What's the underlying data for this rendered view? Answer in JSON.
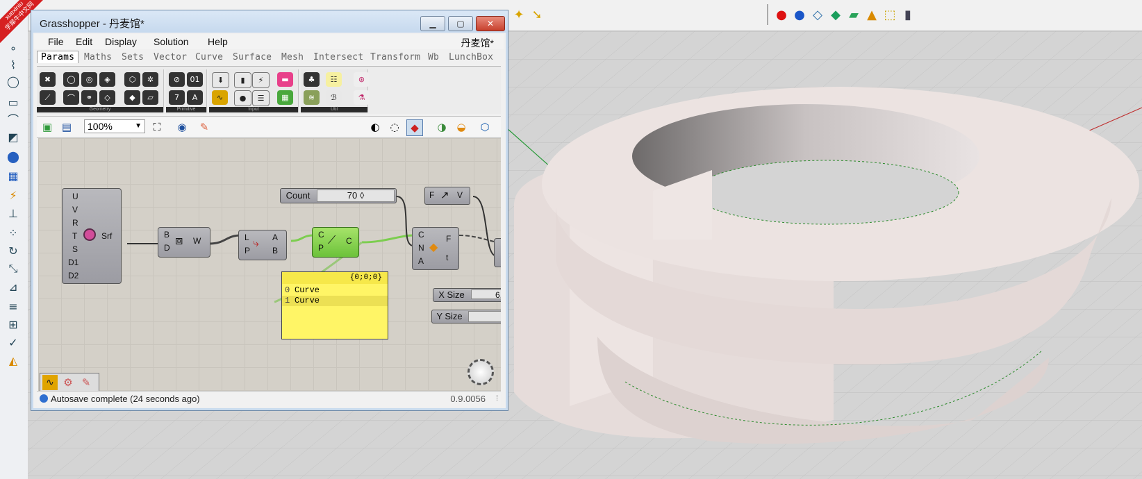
{
  "corner_badge": {
    "line1": "xuexiniu",
    "line2": "学犀牛中文网"
  },
  "window": {
    "title": "Grasshopper - 丹麦馆*",
    "doc_name": "丹麦馆*",
    "btn_min": "▁",
    "btn_max": "▢",
    "btn_close": "✕"
  },
  "menu": [
    "File",
    "Edit",
    "Display",
    "Solution",
    "Help"
  ],
  "tabs": [
    "Params",
    "Maths",
    "Sets",
    "Vector",
    "Curve",
    "Surface",
    "Mesh",
    "Intersect",
    "Transform",
    "Wb",
    "LunchBox"
  ],
  "ribbon_groups": [
    "Geometry",
    "Primitive",
    "Input",
    "Util"
  ],
  "canvas_toolbar": {
    "zoom": "100%"
  },
  "nodes": {
    "surface_param": {
      "inputs": [
        "U",
        "V",
        "R",
        "T",
        "S",
        "D1",
        "D2"
      ],
      "output": "Srf"
    },
    "box_node": {
      "inputs": [
        "B",
        "D"
      ],
      "output": "W"
    },
    "flip_node": {
      "inputs": [
        "L",
        "P"
      ],
      "outputs": [
        "A",
        "B"
      ]
    },
    "project_node": {
      "inputs": [
        "C",
        "P"
      ],
      "output": "C"
    },
    "count_slider": {
      "label": "Count",
      "value": "70 ◊"
    },
    "vector_node": {
      "input": "F",
      "output": "V"
    },
    "divide_node": {
      "inputs": [
        "C",
        "N",
        "A"
      ],
      "outputs": [
        "F",
        "t"
      ]
    },
    "x_size": {
      "label": "X Size",
      "value": "6."
    },
    "y_size": {
      "label": "Y Size"
    }
  },
  "panel": {
    "header": "{0;0;0}",
    "rows": [
      {
        "index": "0",
        "text": "Curve"
      },
      {
        "index": "1",
        "text": "Curve"
      }
    ]
  },
  "status": {
    "text": "Autosave complete (24 seconds ago)",
    "version": "0.9.0056"
  },
  "colors": {
    "gh_green": "#8fdc4c",
    "panel_yellow": "#fff566",
    "rhino_red": "#cc3333"
  }
}
